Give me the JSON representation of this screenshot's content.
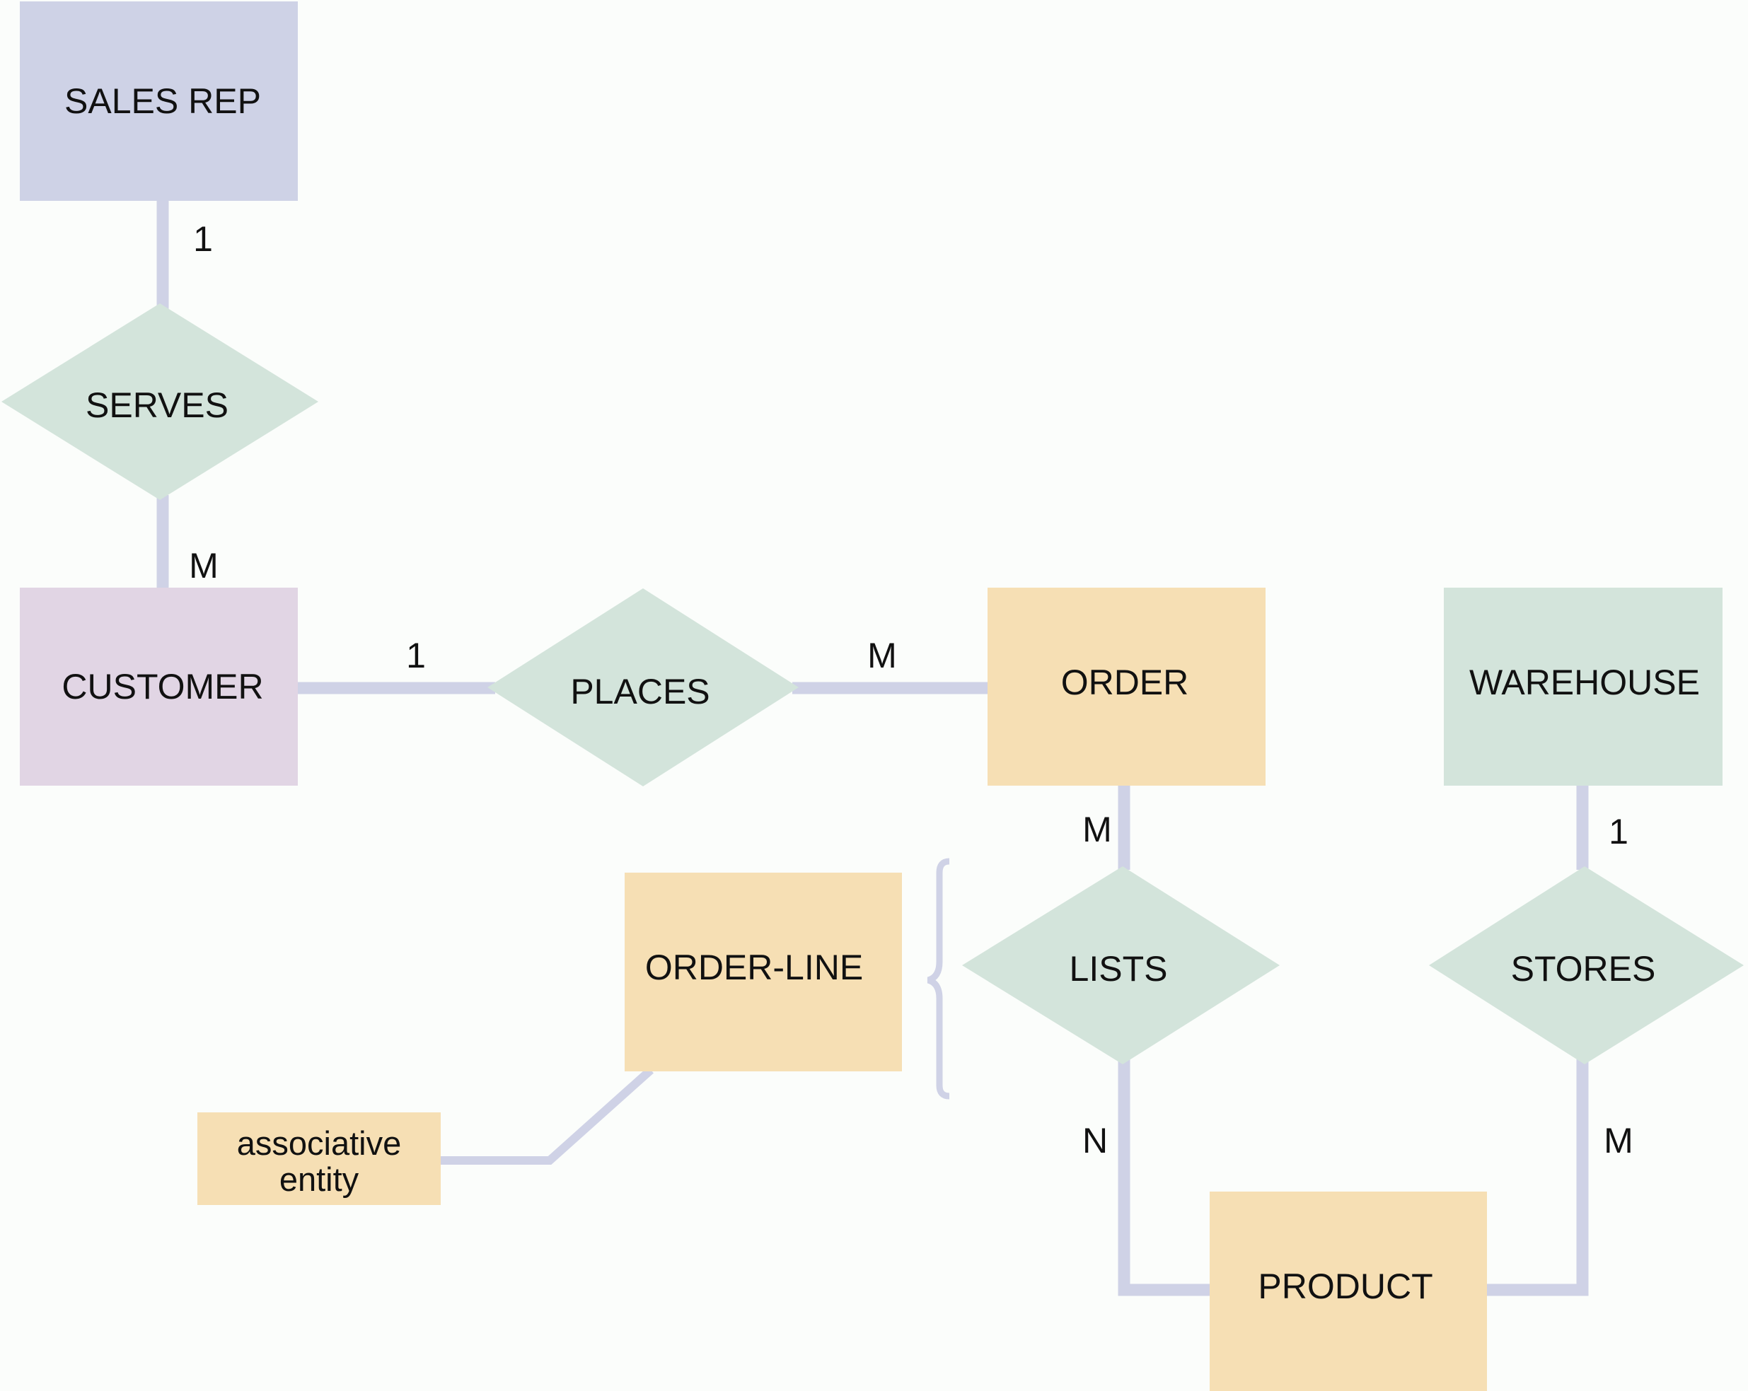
{
  "diagram": {
    "type": "entity-relationship",
    "colors": {
      "background": "#fbfdfb",
      "connector": "#cfd2e6",
      "sales_rep": "#ced2e6",
      "customer": "#e1d5e4",
      "order": "#f6dfb4",
      "order_line": "#f6dfb4",
      "product": "#f6dfb4",
      "warehouse": "#d3e4db",
      "relationship": "#d3e4db",
      "note": "#f6dfb4"
    },
    "entities": [
      {
        "id": "sales_rep",
        "label": "SALES REP"
      },
      {
        "id": "customer",
        "label": "CUSTOMER"
      },
      {
        "id": "order",
        "label": "ORDER"
      },
      {
        "id": "warehouse",
        "label": "WAREHOUSE"
      },
      {
        "id": "order_line",
        "label": "ORDER-LINE"
      },
      {
        "id": "product",
        "label": "PRODUCT"
      }
    ],
    "relationships": [
      {
        "id": "serves",
        "label": "SERVES"
      },
      {
        "id": "places",
        "label": "PLACES"
      },
      {
        "id": "lists",
        "label": "LISTS"
      },
      {
        "id": "stores",
        "label": "STORES"
      }
    ],
    "cardinalities": {
      "sales_rep_serves": "1",
      "serves_customer": "M",
      "customer_places": "1",
      "places_order": "M",
      "order_lists": "M",
      "lists_product": "N",
      "warehouse_stores": "1",
      "stores_product": "M"
    },
    "note": {
      "line1": "associative",
      "line2": "entity"
    }
  }
}
